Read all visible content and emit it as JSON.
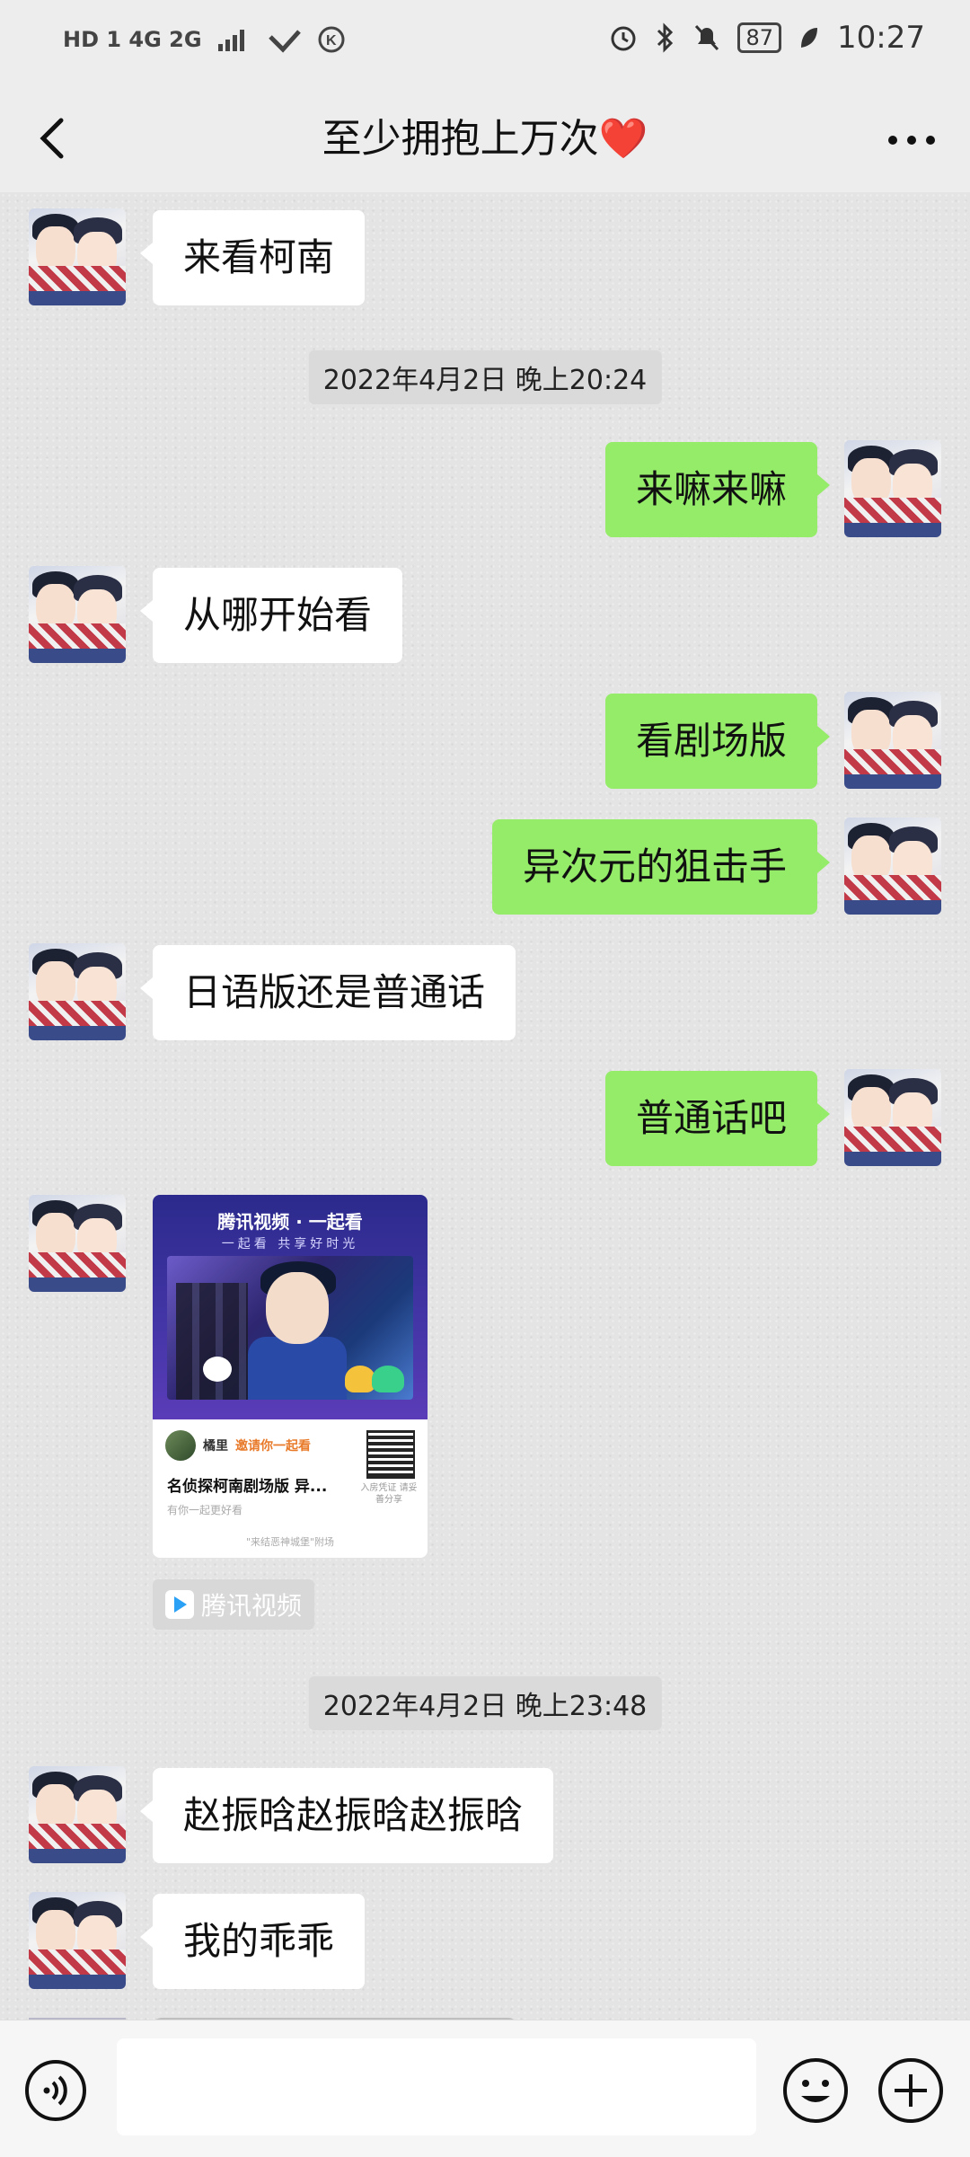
{
  "status_bar": {
    "network_left": "HD 1  4G  2G",
    "battery": "87",
    "time": "10:27"
  },
  "header": {
    "title": "至少拥抱上万次❤️"
  },
  "messages": [
    {
      "side": "in",
      "text": "来看柯南"
    },
    {
      "type": "timestamp",
      "text": "2022年4月2日 晚上20:24"
    },
    {
      "side": "out",
      "text": "来嘛来嘛"
    },
    {
      "side": "in",
      "text": "从哪开始看"
    },
    {
      "side": "out",
      "text": "看剧场版"
    },
    {
      "side": "out",
      "text": "异次元的狙击手"
    },
    {
      "side": "in",
      "text": "日语版还是普通话"
    },
    {
      "side": "out",
      "text": "普通话吧"
    },
    {
      "type": "timestamp",
      "text": "2022年4月2日 晚上23:48"
    },
    {
      "side": "in",
      "text": "赵振晗赵振晗赵振晗"
    },
    {
      "side": "in",
      "text": "我的乖乖"
    }
  ],
  "share_card": {
    "brand": "腾讯视频 · 一起看",
    "slogan": "一起看 共享好时光",
    "user": "橘里",
    "invite": "邀请你一起看",
    "movie_title": "名侦探柯南剧场版 异...",
    "subtitle": "有你一起更好看",
    "qr_caption": "入房凭证 请妥善分享",
    "footer": "\"来结恶神城堡\"附场",
    "app_tag": "腾讯视频"
  },
  "input_bar": {
    "placeholder": ""
  },
  "icons": {
    "back": "back-arrow-icon",
    "more": "more-dots-icon",
    "voice": "voice-icon",
    "emoji": "emoji-icon",
    "plus": "plus-icon"
  },
  "colors": {
    "outgoing_bubble": "#95ec69",
    "incoming_bubble": "#ffffff",
    "header_bg": "#ededed"
  }
}
